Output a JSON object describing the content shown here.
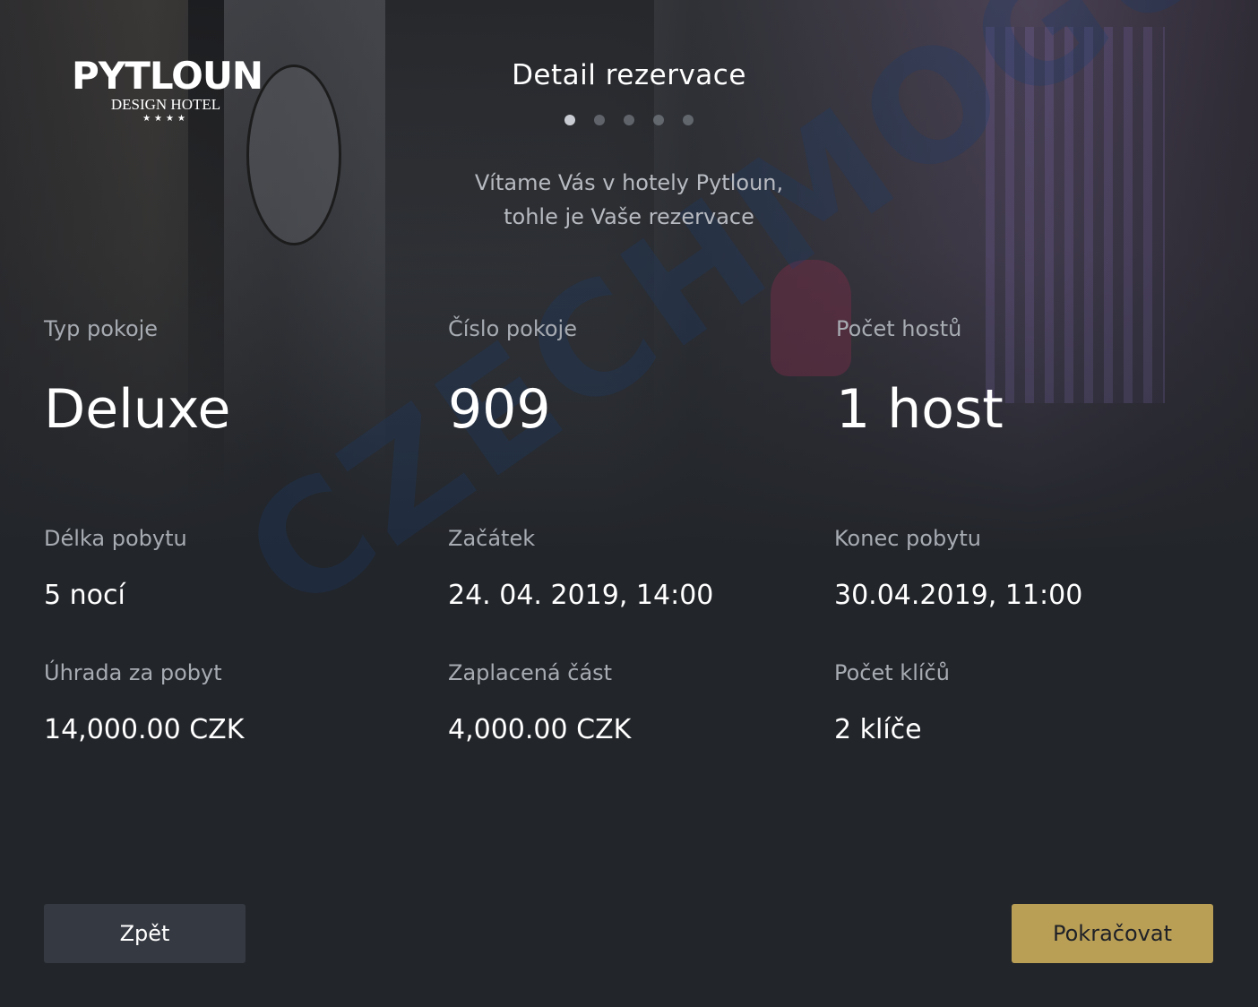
{
  "logo": {
    "name": "PYTLOUN",
    "subtitle": "DESIGN HOTEL",
    "stars": "★★★★"
  },
  "header": {
    "title": "Detail rezervace",
    "steps_total": 5,
    "steps_active": 1
  },
  "welcome": {
    "line1": "Vítame Vás v hotely Pytloun,",
    "line2": "tohle je Vaše rezervace"
  },
  "watermark": "CZECHMOGUL",
  "reservation": {
    "room_type": {
      "label": "Typ pokoje",
      "value": "Deluxe"
    },
    "room_number": {
      "label": "Číslo pokoje",
      "value": "909"
    },
    "guests": {
      "label": "Počet hostů",
      "value": "1 host"
    },
    "stay_length": {
      "label": "Délka pobytu",
      "value": "5 nocí"
    },
    "start": {
      "label": "Začátek",
      "value": "24. 04. 2019, 14:00"
    },
    "end": {
      "label": "Konec pobytu",
      "value": "30.04.2019, 11:00"
    },
    "payment": {
      "label": "Úhrada za pobyt",
      "value": "14,000.00 CZK"
    },
    "paid": {
      "label": "Zaplacená část",
      "value": "4,000.00 CZK"
    },
    "keys": {
      "label": "Počet klíčů",
      "value": "2 klíče"
    }
  },
  "buttons": {
    "back_label": "Zpět",
    "continue_label": "Pokračovat"
  },
  "colors": {
    "background": "#22252a",
    "accent": "#b99f56",
    "secondary_button": "#353941",
    "label": "#a7abb2"
  }
}
